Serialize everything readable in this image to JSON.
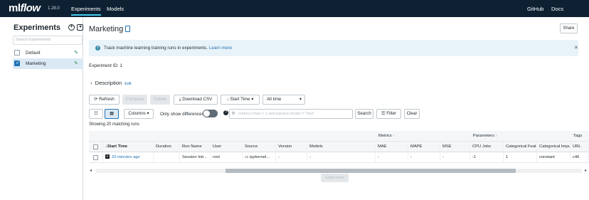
{
  "topbar": {
    "logo_ml": "ml",
    "logo_flow": "flow",
    "version": "1.28.0",
    "nav": [
      "Experiments",
      "Models"
    ],
    "right_nav": [
      "GitHub",
      "Docs"
    ]
  },
  "sidebar": {
    "title": "Experiments",
    "add_icon": "+",
    "collapse_icon": "◂",
    "search_placeholder": "Search Experiments",
    "experiments": [
      {
        "label": "Default",
        "selected": false
      },
      {
        "label": "Marketing",
        "selected": true
      }
    ]
  },
  "main": {
    "title": "Marketing",
    "share_label": "Share",
    "info_text": "Track machine learning training runs in experiments.",
    "info_link": "Learn more",
    "experiment_id_label": "Experiment ID:",
    "experiment_id_value": "1",
    "description_label": "Description",
    "description_edit": "Edit",
    "toolbar": {
      "refresh": "Refresh",
      "compare": "Compare",
      "delete": "Delete",
      "download": "Download CSV",
      "sort": "Start Time",
      "time": "All time",
      "columns": "Columns",
      "only_diff": "Only show differences",
      "search_placeholder": "metrics.rmse < 1 and params.model = \"tree\"",
      "search": "Search",
      "filter": "Filter",
      "clear": "Clear"
    },
    "showing": "Showing 20 matching runs",
    "table": {
      "groups": [
        "Metrics",
        "Parameters",
        "Tags"
      ],
      "headers": [
        "Start Time",
        "Duration",
        "Run Name",
        "User",
        "Source",
        "Version",
        "Models",
        "MAE",
        "MAPE",
        "MSE",
        "CPU Jobs",
        "Categorical Feat",
        "Categorical Impu",
        "URL"
      ],
      "row": [
        "20 minutes ago",
        "",
        "Session Init...",
        "root",
        "ipykernel...",
        "-",
        "-",
        "-",
        "-",
        "-",
        "-1",
        "1",
        "constant",
        "c46"
      ]
    },
    "load_more": "Load more"
  }
}
